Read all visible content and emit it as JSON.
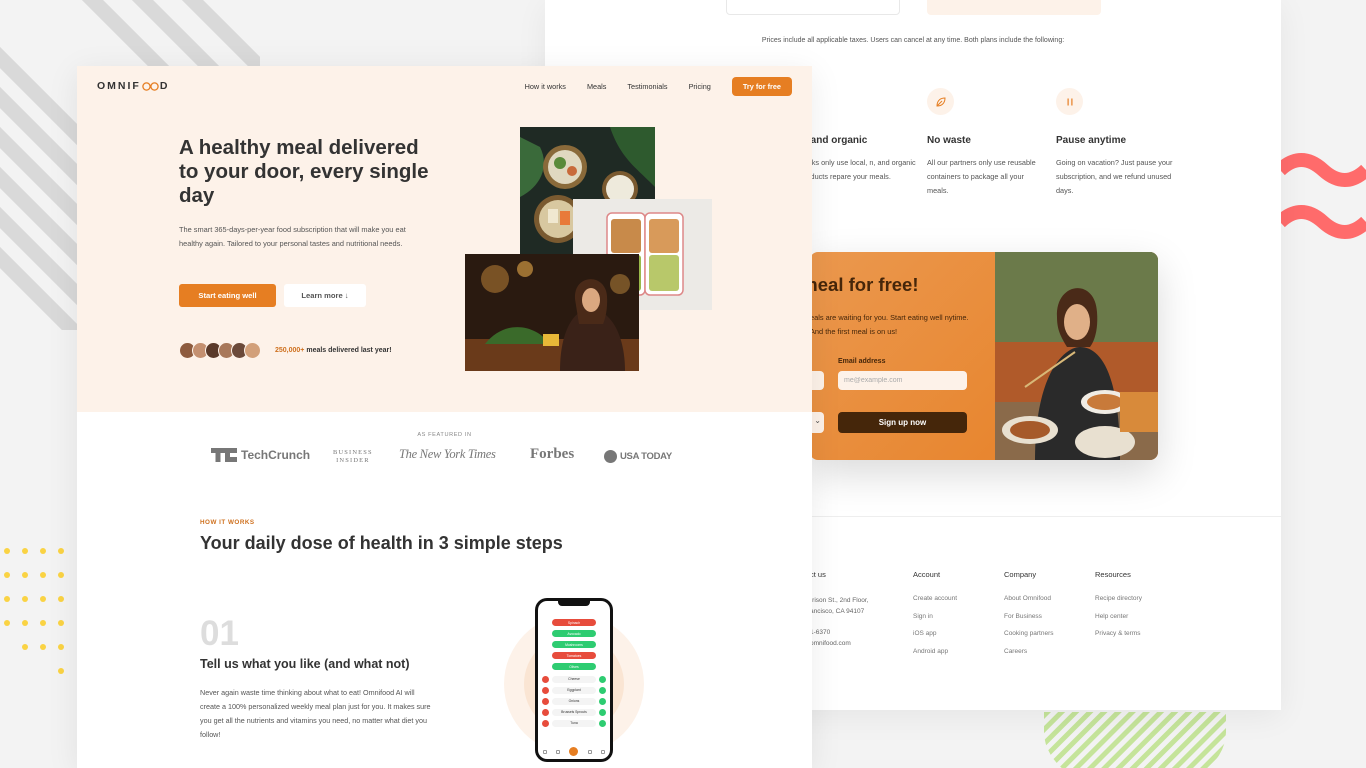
{
  "colors": {
    "primary": "#e67e22",
    "primary_dark": "#cf711f",
    "hero_bg": "#fdf2e9",
    "cta_dark": "#45260a",
    "wave": "#ff6b6b",
    "dots": "#fad343",
    "stripes": "#d9d9d9",
    "green_stripes": "#c5e49a"
  },
  "front": {
    "logo": {
      "left": "OMNIF",
      "right": "D",
      "icon": "infinity-icon"
    },
    "nav": {
      "items": [
        "How it works",
        "Meals",
        "Testimonials",
        "Pricing"
      ],
      "cta": "Try for free"
    },
    "hero": {
      "title": "A healthy meal delivered to your door, every single day",
      "description": "The smart 365-days-per-year food subscription that will make you eat healthy again. Tailored to your personal tastes and nutritional needs.",
      "primary_button": "Start eating well",
      "secondary_button": "Learn more ↓",
      "delivered_count": "250,000+",
      "delivered_text": " meals delivered last year!",
      "avatar_colors": [
        "#8d5b3e",
        "#c49070",
        "#5a3a2a",
        "#a8785a",
        "#6b4a3a",
        "#d2a07a"
      ]
    },
    "featured": {
      "label": "AS FEATURED IN",
      "logos": [
        "TechCrunch",
        "BUSINESS",
        "INSIDER",
        "The New York Times",
        "Forbes",
        "USA TODAY"
      ]
    },
    "how_it_works": {
      "label": "HOW IT WORKS",
      "title": "Your daily dose of health in 3 simple steps",
      "step": {
        "number": "01",
        "title": "Tell us what you like (and what not)",
        "text": "Never again waste time thinking about what to eat! Omnifood AI will create a 100% personalized weekly meal plan just for you. It makes sure you get all the nutrients and vitamins you need, no matter what diet you follow!"
      }
    },
    "phone": {
      "pills": [
        {
          "label": "Spinach",
          "status": "red"
        },
        {
          "label": "Avocado",
          "status": "green"
        },
        {
          "label": "Mushrooms",
          "status": "green"
        },
        {
          "label": "Tomatoes",
          "status": "red"
        },
        {
          "label": "Olives",
          "status": "green"
        }
      ],
      "rows": [
        "Cheese",
        "Eggplant",
        "Onions",
        "Brussels Sprouts",
        "Tuna"
      ]
    }
  },
  "back": {
    "pricing_note": "Prices include all applicable taxes. Users can cancel at any time. Both plans include the following:",
    "features": [
      {
        "title": "cal and organic",
        "icon": "globe-icon",
        "text": "cooks only use local, n, and organic products repare your meals."
      },
      {
        "title": "No waste",
        "icon": "leaf-icon",
        "text": "All our partners only use reusable containers to package all your meals."
      },
      {
        "title": "Pause anytime",
        "icon": "pause-icon",
        "text": "Going on vacation? Just pause your subscription, and we refund unused days."
      }
    ],
    "cta": {
      "title": "t meal for free!",
      "text": "eals are waiting for you. Start eating well nytime. And the first meal is on us!",
      "email_label": "Email address",
      "email_placeholder": "me@example.com",
      "button": "Sign up now",
      "select_chevron": "⌄"
    },
    "footer": {
      "contact": {
        "title": "ct us",
        "lines": [
          "rrison St., 2nd Floor,",
          "ancisco, CA 94107",
          "",
          "1-6370",
          "omnifood.com"
        ]
      },
      "account": {
        "title": "Account",
        "links": [
          "Create account",
          "Sign in",
          "iOS app",
          "Android app"
        ]
      },
      "company": {
        "title": "Company",
        "links": [
          "About Omnifood",
          "For Business",
          "Cooking partners",
          "Careers"
        ]
      },
      "resources": {
        "title": "Resources",
        "links": [
          "Recipe directory",
          "Help center",
          "Privacy & terms"
        ]
      }
    }
  }
}
